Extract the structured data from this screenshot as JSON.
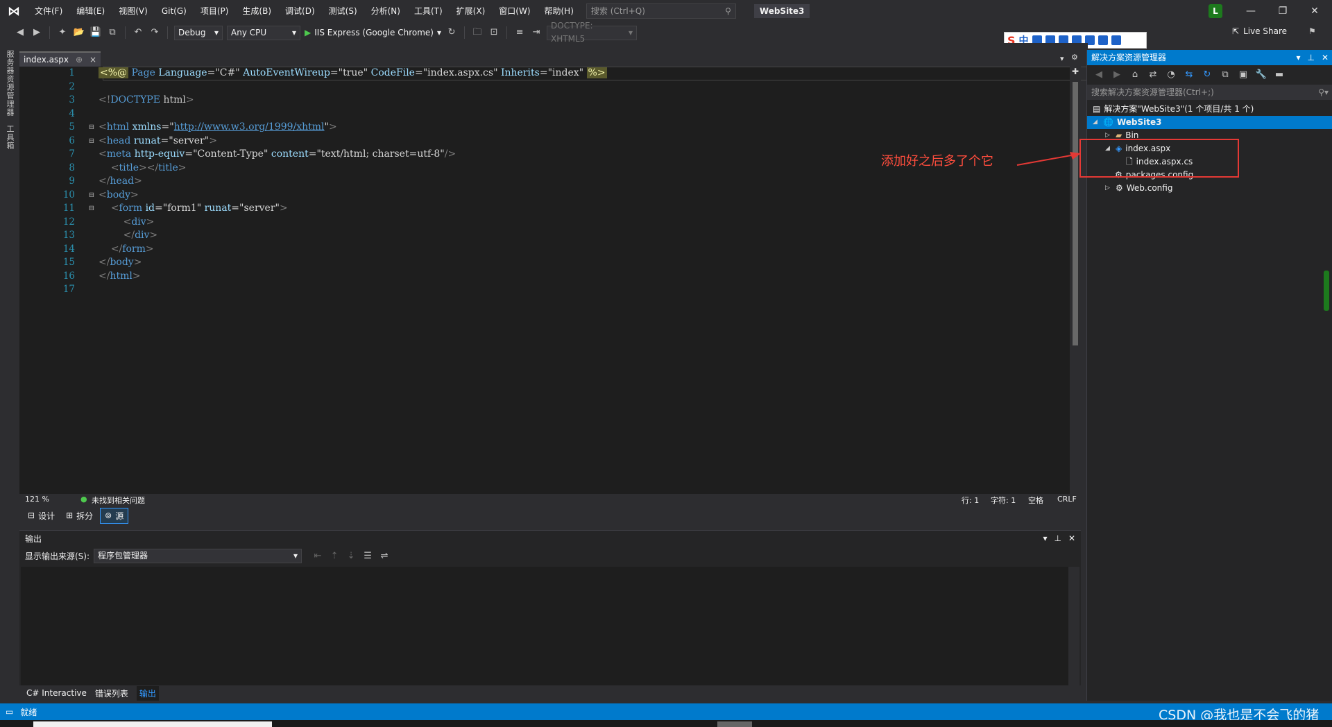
{
  "menu": [
    "文件(F)",
    "编辑(E)",
    "视图(V)",
    "Git(G)",
    "项目(P)",
    "生成(B)",
    "调试(D)",
    "测试(S)",
    "分析(N)",
    "工具(T)",
    "扩展(X)",
    "窗口(W)",
    "帮助(H)"
  ],
  "search": {
    "placeholder": "搜索 (Ctrl+Q)"
  },
  "app_name": "WebSite3",
  "user_initial": "L",
  "toolbar": {
    "config": "Debug",
    "platform": "Any CPU",
    "run_label": "IIS Express (Google Chrome)",
    "doctype": "DOCTYPE: XHTML5",
    "live_share": "Live Share"
  },
  "ime": {
    "lang": "中"
  },
  "left_tabs": [
    "服务器资源管理器",
    "工具箱"
  ],
  "doc_tab": {
    "name": "index.aspx",
    "pin": "⊕",
    "close": "×"
  },
  "code_lines": [
    {
      "n": "1",
      "html": "<span class=\"dir\">&lt;%@</span> <span class=\"t\">Page</span> <span class=\"a\">Language</span>=<span class=\"v\">\"C#\"</span> <span class=\"a\">AutoEventWireup</span>=<span class=\"v\">\"true\"</span> <span class=\"a\">CodeFile</span>=<span class=\"v\">\"index.aspx.cs\"</span> <span class=\"a\">Inherits</span>=<span class=\"v\">\"index\"</span> <span class=\"dir\">%&gt;</span>",
      "fold": ""
    },
    {
      "n": "2",
      "html": "",
      "fold": ""
    },
    {
      "n": "3",
      "html": "<span class=\"d\">&lt;!</span><span class=\"t\">DOCTYPE</span> <span class=\"k\">html</span><span class=\"d\">&gt;</span>",
      "fold": ""
    },
    {
      "n": "4",
      "html": "",
      "fold": ""
    },
    {
      "n": "5",
      "html": "<span class=\"d\">&lt;</span><span class=\"t\">html</span> <span class=\"a\">xmlns</span>=<span class=\"v\">\"</span><span class=\"u\">http://www.w3.org/1999/xhtml</span><span class=\"v\">\"</span><span class=\"d\">&gt;</span>",
      "fold": "⊟"
    },
    {
      "n": "6",
      "html": "<span class=\"d\">&lt;</span><span class=\"t\">head</span> <span class=\"a\">runat</span>=<span class=\"v\">\"server\"</span><span class=\"d\">&gt;</span>",
      "fold": "⊟"
    },
    {
      "n": "7",
      "html": "<span class=\"d\">&lt;</span><span class=\"t\">meta</span> <span class=\"a\">http-equiv</span>=<span class=\"v\">\"Content-Type\"</span> <span class=\"a\">content</span>=<span class=\"v\">\"text/html; charset=utf-8\"</span><span class=\"d\">/&gt;</span>",
      "fold": ""
    },
    {
      "n": "8",
      "html": "    <span class=\"d\">&lt;</span><span class=\"t\">title</span><span class=\"d\">&gt;&lt;/</span><span class=\"t\">title</span><span class=\"d\">&gt;</span>",
      "fold": ""
    },
    {
      "n": "9",
      "html": "<span class=\"d\">&lt;/</span><span class=\"t\">head</span><span class=\"d\">&gt;</span>",
      "fold": ""
    },
    {
      "n": "10",
      "html": "<span class=\"d\">&lt;</span><span class=\"t\">body</span><span class=\"d\">&gt;</span>",
      "fold": "⊟"
    },
    {
      "n": "11",
      "html": "    <span class=\"d\">&lt;</span><span class=\"t\">form</span> <span class=\"a\">id</span>=<span class=\"v\">\"form1\"</span> <span class=\"a\">runat</span>=<span class=\"v\">\"server\"</span><span class=\"d\">&gt;</span>",
      "fold": "⊟"
    },
    {
      "n": "12",
      "html": "        <span class=\"d\">&lt;</span><span class=\"t\">div</span><span class=\"d\">&gt;</span>",
      "fold": ""
    },
    {
      "n": "13",
      "html": "        <span class=\"d\">&lt;/</span><span class=\"t\">div</span><span class=\"d\">&gt;</span>",
      "fold": ""
    },
    {
      "n": "14",
      "html": "    <span class=\"d\">&lt;/</span><span class=\"t\">form</span><span class=\"d\">&gt;</span>",
      "fold": ""
    },
    {
      "n": "15",
      "html": "<span class=\"d\">&lt;/</span><span class=\"t\">body</span><span class=\"d\">&gt;</span>",
      "fold": ""
    },
    {
      "n": "16",
      "html": "<span class=\"d\">&lt;/</span><span class=\"t\">html</span><span class=\"d\">&gt;</span>",
      "fold": ""
    },
    {
      "n": "17",
      "html": "",
      "fold": ""
    }
  ],
  "editor_status": {
    "zoom": "121 %",
    "issues": "未找到相关问题",
    "line": "行: 1",
    "char": "字符: 1",
    "spaces": "空格",
    "eol": "CRLF"
  },
  "view_tabs": {
    "design": "设计",
    "split": "拆分",
    "source": "源"
  },
  "output": {
    "title": "输出",
    "source_label": "显示输出来源(S):",
    "source_value": "程序包管理器"
  },
  "bottom_tabs": [
    "C# Interactive",
    "错误列表",
    "输出"
  ],
  "solution": {
    "title": "解决方案资源管理器",
    "search": "搜索解决方案资源管理器(Ctrl+;)",
    "root": "解决方案\"WebSite3\"(1 个项目/共 1 个)",
    "project": "WebSite3",
    "items": [
      "Bin",
      "index.aspx",
      "index.aspx.cs",
      "packages.config",
      "Web.config"
    ]
  },
  "annotation": "添加好之后多了个它",
  "statusbar": {
    "ready": "就绪"
  },
  "watermark": "CSDN @我也是不会飞的猪",
  "colors": {
    "accent": "#007acc",
    "annotation": "#e53935"
  }
}
